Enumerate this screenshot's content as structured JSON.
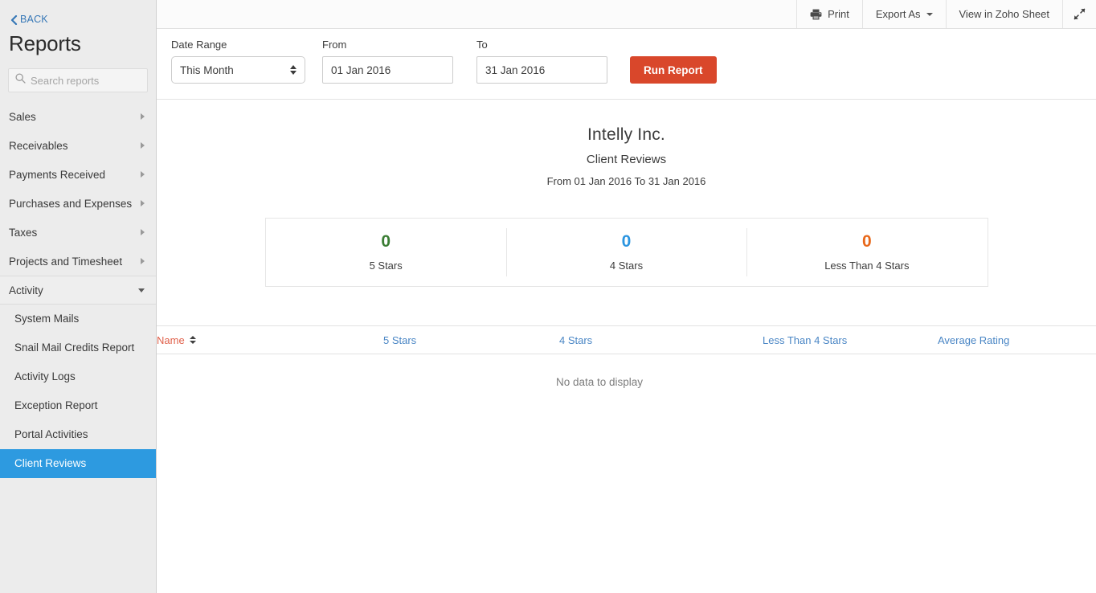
{
  "sidebar": {
    "back_label": "BACK",
    "back_icon": "chevron-left-icon",
    "title": "Reports",
    "search": {
      "placeholder": "Search reports",
      "value": "",
      "icon": "search-icon"
    },
    "groups": [
      {
        "label": "Sales",
        "expanded": false,
        "icon": "chevron-right-icon"
      },
      {
        "label": "Receivables",
        "expanded": false,
        "icon": "chevron-right-icon"
      },
      {
        "label": "Payments Received",
        "expanded": false,
        "icon": "chevron-right-icon"
      },
      {
        "label": "Purchases and Expenses",
        "expanded": false,
        "icon": "chevron-right-icon"
      },
      {
        "label": "Taxes",
        "expanded": false,
        "icon": "chevron-right-icon"
      },
      {
        "label": "Projects and Timesheet",
        "expanded": false,
        "icon": "chevron-right-icon"
      },
      {
        "label": "Activity",
        "expanded": true,
        "icon": "chevron-down-icon"
      }
    ],
    "activity_items": [
      {
        "label": "System Mails",
        "active": false
      },
      {
        "label": "Snail Mail Credits Report",
        "active": false
      },
      {
        "label": "Activity Logs",
        "active": false
      },
      {
        "label": "Exception Report",
        "active": false
      },
      {
        "label": "Portal Activities",
        "active": false
      },
      {
        "label": "Client Reviews",
        "active": true
      }
    ],
    "active_color": "#2d9ae0"
  },
  "toolbar": {
    "print_label": "Print",
    "print_icon": "printer-icon",
    "export_label": "Export As",
    "export_caret_icon": "caret-down-icon",
    "zoho_sheet_label": "View in Zoho Sheet",
    "expand_icon": "expand-diagonal-icon"
  },
  "filters": {
    "date_range_label": "Date Range",
    "date_range_value": "This Month",
    "date_range_options": [
      "This Month"
    ],
    "from_label": "From",
    "from_value": "01 Jan 2016",
    "to_label": "To",
    "to_value": "31 Jan 2016",
    "run_label": "Run Report",
    "run_color": "#d9472b"
  },
  "report": {
    "company": "Intelly Inc.",
    "name": "Client Reviews",
    "range": "From 01 Jan 2016 To 31 Jan 2016",
    "summary": [
      {
        "value": "0",
        "label": "5 Stars",
        "color": "#3a7d34"
      },
      {
        "value": "0",
        "label": "4 Stars",
        "color": "#2b95e0"
      },
      {
        "value": "0",
        "label": "Less Than 4 Stars",
        "color": "#e8681a"
      }
    ],
    "table": {
      "columns": [
        {
          "label": "Name",
          "sorted": true,
          "sort_icon": "sort-updown-icon",
          "color": "#e0604a"
        },
        {
          "label": "5 Stars",
          "sorted": false,
          "color": "#4a86c5"
        },
        {
          "label": "4 Stars",
          "sorted": false,
          "color": "#4a86c5"
        },
        {
          "label": "Less Than 4 Stars",
          "sorted": false,
          "color": "#4a86c5"
        },
        {
          "label": "Average Rating",
          "sorted": false,
          "color": "#4a86c5"
        }
      ],
      "rows": [],
      "empty_message": "No data to display"
    }
  }
}
